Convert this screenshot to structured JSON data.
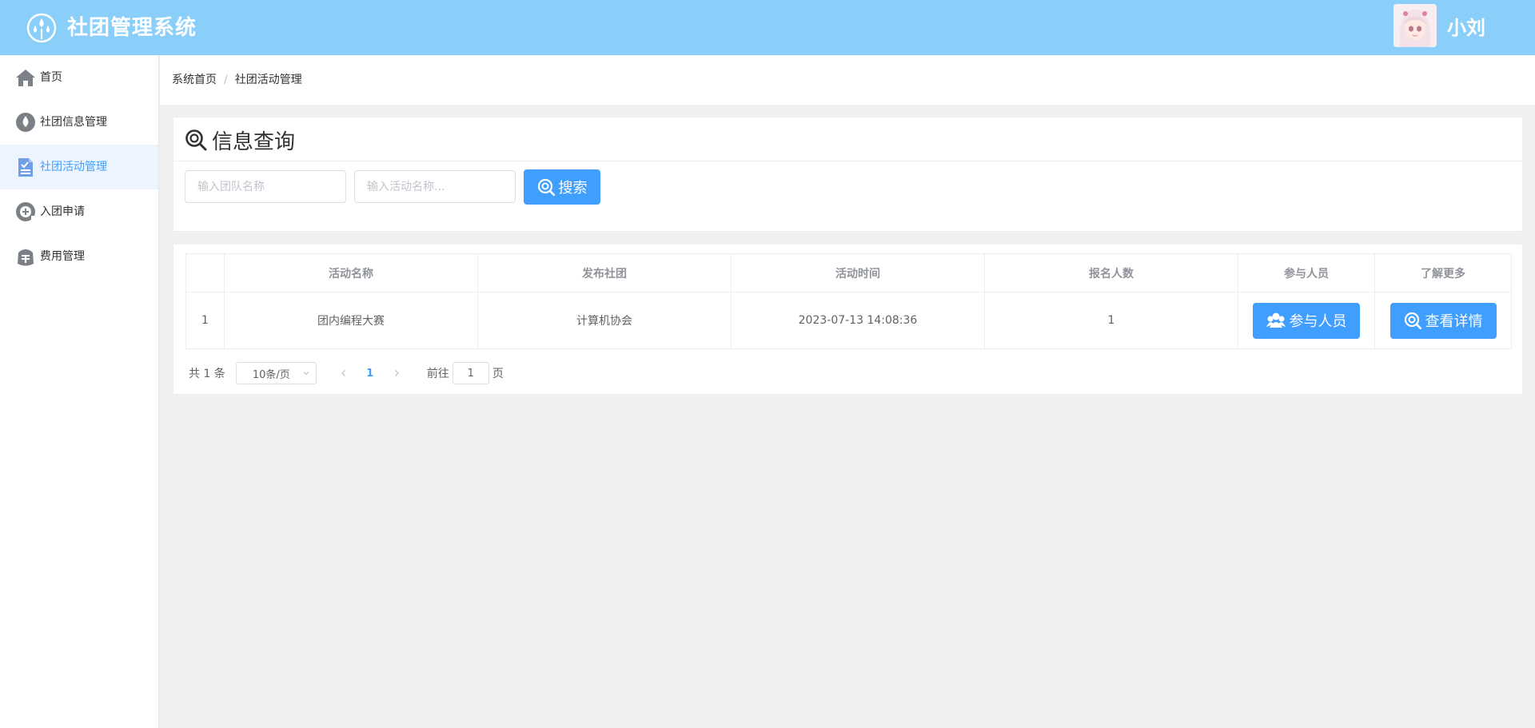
{
  "header": {
    "app_title": "社团管理系统",
    "username": "小刘",
    "background_color": "#89cff9"
  },
  "sidebar": {
    "items": [
      {
        "label": "首页",
        "icon": "home-icon",
        "active": false
      },
      {
        "label": "社团信息管理",
        "icon": "drop-icon",
        "active": false
      },
      {
        "label": "社团活动管理",
        "icon": "document-icon",
        "active": true
      },
      {
        "label": "入团申请",
        "icon": "plus-circle-icon",
        "active": false
      },
      {
        "label": "费用管理",
        "icon": "money-icon",
        "active": false
      }
    ]
  },
  "breadcrumb": {
    "items": [
      "系统首页",
      "社团活动管理"
    ],
    "separator": "/"
  },
  "search": {
    "title": "信息查询",
    "team_placeholder": "输入团队名称",
    "activity_placeholder": "输入活动名称...",
    "search_label": "搜索"
  },
  "table": {
    "headers": [
      "",
      "活动名称",
      "发布社团",
      "活动时间",
      "报名人数",
      "参与人员",
      "了解更多"
    ],
    "rows": [
      {
        "index": "1",
        "name": "团内编程大赛",
        "club": "计算机协会",
        "time": "2023-07-13 14:08:36",
        "signups": "1",
        "participants_label": "参与人员",
        "details_label": "查看详情"
      }
    ]
  },
  "pagination": {
    "total": "共 1 条",
    "page_size": "10条/页",
    "current_page": "1",
    "goto_label": "前往",
    "goto_value": "1",
    "page_suffix": "页"
  },
  "colors": {
    "primary": "#409eff",
    "active_bg": "#ecf5ff"
  }
}
